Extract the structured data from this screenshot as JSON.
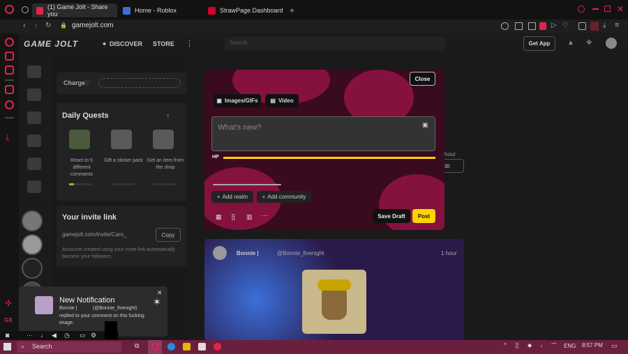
{
  "browser": {
    "tabs": [
      {
        "label": "(1) Game Jolt - Share you"
      },
      {
        "label": "Home - Roblox"
      },
      {
        "label": "StrawPage Dashboard"
      }
    ],
    "address": "gamejolt.com"
  },
  "gj_nav": {
    "logo": "GAME JOLT",
    "discover": "DISCOVER",
    "store": "STORE",
    "search_placeholder": "Search",
    "get_app": "Get App"
  },
  "left_panel": {
    "charge_label": "Charge",
    "daily_quests_title": "Daily Quests",
    "quests": [
      {
        "label": "React to 5 different comments"
      },
      {
        "label": "Gift a sticker pack"
      },
      {
        "label": "Get an item from the shop"
      }
    ],
    "invite_title": "Your invite link",
    "invite_value": "gamejolt.com/invite/Caro_",
    "copy_label": "Copy",
    "invite_note": "Accounts created using your invite link automatically become your followers."
  },
  "composer": {
    "close_label": "Close",
    "tab_images": "Images/GIFs",
    "tab_video": "Video",
    "placeholder": "What's new?",
    "hp_label": "HP",
    "add_realm": "Add realm",
    "add_community": "Add community",
    "save_draft": "Save Draft",
    "post": "Post",
    "edit_label": "dit",
    "hour_label": "hour"
  },
  "feed_post": {
    "author": "Bonnie |",
    "handle": "@Bonnie_fivenight",
    "time": "1 hour"
  },
  "notification": {
    "title": "New Notification",
    "line1": "Bonnie |",
    "handle": "(@Bonnie_fivenight)",
    "body": "replied to your comment on this fucking image."
  },
  "taskbar": {
    "search": "Search",
    "lang": "ENG",
    "time": "8:57 PM"
  },
  "colors": {
    "accent": "#e0254d",
    "gj_yellow": "#ffd400",
    "modal_splat": "#c2185b"
  }
}
